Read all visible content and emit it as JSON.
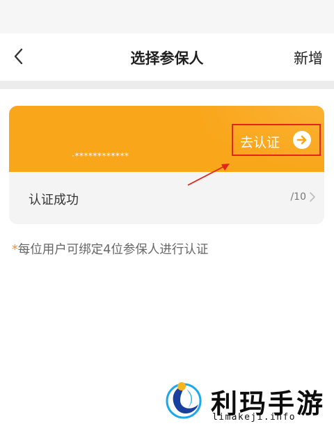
{
  "nav": {
    "back_icon": "chevron-left-icon",
    "title": "选择参保人",
    "action_label": "新增"
  },
  "card": {
    "masked_name": "·************",
    "verify_label": "去认证",
    "verify_icon": "arrow-right-circle-icon",
    "status_text": "认证成功",
    "count_text": "/10",
    "chevron_icon": "chevron-right-icon",
    "accent_color": "#f9a61a",
    "highlight_color": "#e3241c"
  },
  "note": {
    "star": "*",
    "text": "每位用户可绑定4位参保人进行认证"
  },
  "watermark": {
    "brand_text": "利玛手游",
    "url_text": "limakeji.info"
  }
}
